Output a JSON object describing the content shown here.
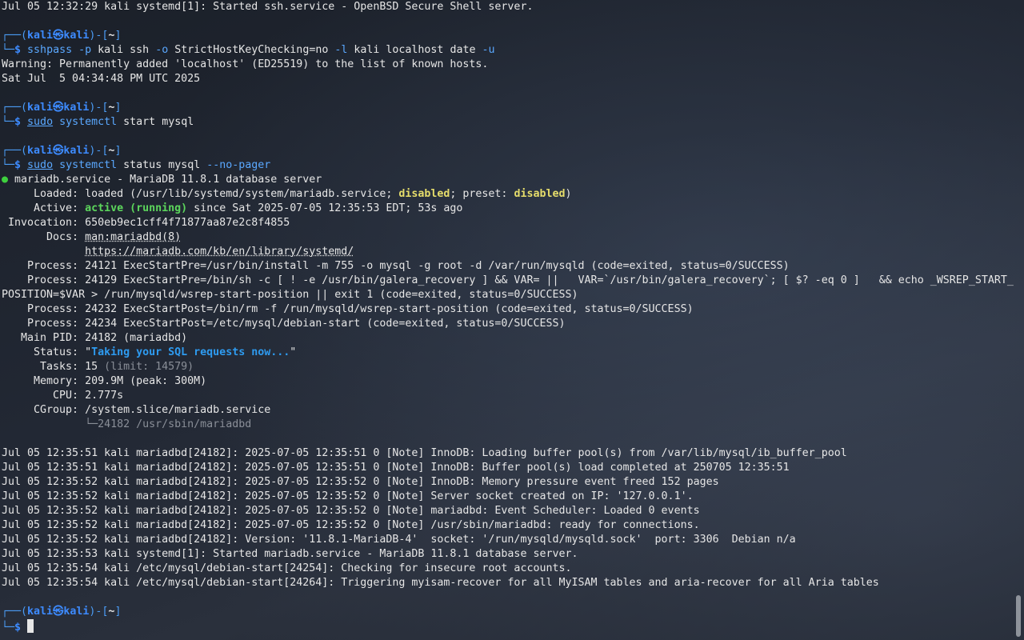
{
  "terminal": {
    "prompt": {
      "corner_top": "┌──(",
      "user": "kali",
      "at": "㉿",
      "host": "kali",
      "mid": ")-[",
      "dir": "~",
      "close": "]",
      "corner_bottom": "└─",
      "dollar": "$"
    },
    "line_0": "Jul 05 12:32:29 kali systemd[1]: Started ssh.service - OpenBSD Secure Shell server.",
    "cmd1": {
      "tool": "sshpass",
      "args_a": " -p",
      "args_b": " kali ssh ",
      "args_c": "-o",
      "args_d": " StrictHostKeyChecking=no ",
      "args_e": "-l",
      "args_f": " kali localhost date ",
      "args_g": "-u"
    },
    "out1_a": "Warning: Permanently added 'localhost' (ED25519) to the list of known hosts.",
    "out1_b": "Sat Jul  5 04:34:48 PM UTC 2025",
    "cmd2": {
      "sudo": "sudo",
      "systemctl": "systemctl",
      "rest": " start mysql"
    },
    "cmd3": {
      "sudo": "sudo",
      "systemctl": "systemctl",
      "rest": " status mysql ",
      "flag": "--no-pager"
    },
    "status": {
      "dot": "●",
      "title": " mariadb.service - MariaDB 11.8.1 database server",
      "loaded_label": "     Loaded: ",
      "loaded_a": "loaded (/usr/lib/systemd/system/mariadb.service; ",
      "disabled1": "disabled",
      "loaded_b": "; preset: ",
      "disabled2": "disabled",
      "loaded_c": ")",
      "active_label": "     Active: ",
      "active_state": "active (running)",
      "active_rest": " since Sat 2025-07-05 12:35:53 EDT; 53s ago",
      "invocation": " Invocation: 650eb9ec1cff4f71877aa87e2c8f4855",
      "docs_label": "       Docs: ",
      "docs_1": "man:mariadbd(8)",
      "docs_pad": "             ",
      "docs_2": "https://mariadb.com/kb/en/library/systemd/",
      "proc1": "    Process: 24121 ExecStartPre=/usr/bin/install -m 755 -o mysql -g root -d /var/run/mysqld (code=exited, status=0/SUCCESS)",
      "proc2": "    Process: 24129 ExecStartPre=/bin/sh -c [ ! -e /usr/bin/galera_recovery ] && VAR= ||   VAR=`/usr/bin/galera_recovery`; [ $? -eq 0 ]   && echo _WSREP_START_",
      "proc2_cont": "POSITION=$VAR > /run/mysqld/wsrep-start-position || exit 1 (code=exited, status=0/SUCCESS)",
      "proc3": "    Process: 24232 ExecStartPost=/bin/rm -f /run/mysqld/wsrep-start-position (code=exited, status=0/SUCCESS)",
      "proc4": "    Process: 24234 ExecStartPost=/etc/mysql/debian-start (code=exited, status=0/SUCCESS)",
      "mainpid": "   Main PID: 24182 (mariadbd)",
      "status_label": "     Status: \"",
      "status_text": "Taking your SQL requests now...",
      "status_end": "\"",
      "tasks_label": "      Tasks: 15 ",
      "tasks_limit": "(limit: 14579)",
      "memory": "     Memory: 209.9M (peak: 300M)",
      "cpu": "        CPU: 2.777s",
      "cgroup": "     CGroup: /system.slice/mariadb.service",
      "cgroup_child": "             └─24182 /usr/sbin/mariadbd"
    },
    "logs": [
      "Jul 05 12:35:51 kali mariadbd[24182]: 2025-07-05 12:35:51 0 [Note] InnoDB: Loading buffer pool(s) from /var/lib/mysql/ib_buffer_pool",
      "Jul 05 12:35:51 kali mariadbd[24182]: 2025-07-05 12:35:51 0 [Note] InnoDB: Buffer pool(s) load completed at 250705 12:35:51",
      "Jul 05 12:35:52 kali mariadbd[24182]: 2025-07-05 12:35:52 0 [Note] InnoDB: Memory pressure event freed 152 pages",
      "Jul 05 12:35:52 kali mariadbd[24182]: 2025-07-05 12:35:52 0 [Note] Server socket created on IP: '127.0.0.1'.",
      "Jul 05 12:35:52 kali mariadbd[24182]: 2025-07-05 12:35:52 0 [Note] mariadbd: Event Scheduler: Loaded 0 events",
      "Jul 05 12:35:52 kali mariadbd[24182]: 2025-07-05 12:35:52 0 [Note] /usr/sbin/mariadbd: ready for connections.",
      "Jul 05 12:35:52 kali mariadbd[24182]: Version: '11.8.1-MariaDB-4'  socket: '/run/mysqld/mysqld.sock'  port: 3306  Debian n/a",
      "Jul 05 12:35:53 kali systemd[1]: Started mariadb.service - MariaDB 11.8.1 database server.",
      "Jul 05 12:35:54 kali /etc/mysql/debian-start[24254]: Checking for insecure root accounts.",
      "Jul 05 12:35:54 kali /etc/mysql/debian-start[24264]: Triggering myisam-recover for all MyISAM tables and aria-recover for all Aria tables"
    ]
  }
}
